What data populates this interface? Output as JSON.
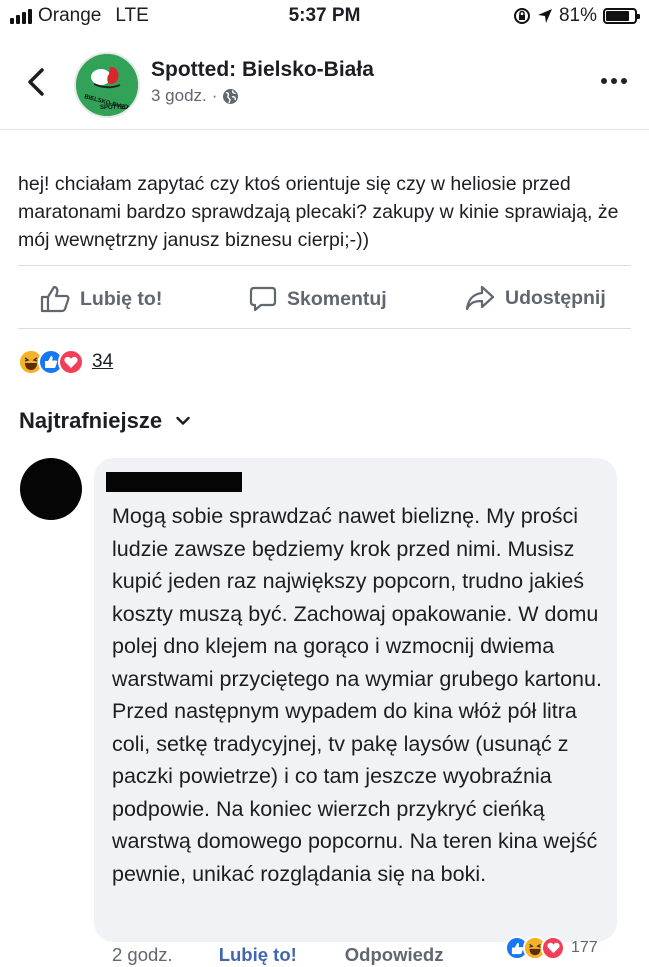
{
  "status_bar": {
    "carrier": "Orange",
    "network": "LTE",
    "time": "5:37 PM",
    "battery": "81%",
    "battery_level": 0.81
  },
  "header": {
    "page_name": "Spotted: Bielsko-Biała",
    "time": "3 godz.",
    "separator": "·",
    "privacy_icon": "globe-icon",
    "avatar_text": "BIELSKO-BIAŁA SPOTTED"
  },
  "post": {
    "text": "hej! chciałam zapytać czy ktoś orientuje się czy w heliosie przed maratonami bardzo sprawdzają plecaki? zakupy w kinie sprawiają, że mój wewnętrzny janusz biznesu cierpi;-))"
  },
  "actions": {
    "like": "Lubię to!",
    "comment": "Skomentuj",
    "share": "Udostępnij"
  },
  "reactions": {
    "icons": [
      "haha-icon",
      "like-icon",
      "love-icon"
    ],
    "count": "34"
  },
  "comments": {
    "sort_label": "Najtrafniejsze",
    "items": [
      {
        "text": "Mogą sobie sprawdzać nawet bieliznę. My prości ludzie zawsze będziemy krok przed nimi. Musisz kupić jeden raz największy popcorn, trudno jakieś koszty muszą być. Zachowaj opakowanie. W domu polej dno klejem na gorąco i wzmocnij dwiema warstwami przyciętego na wymiar grubego kartonu. Przed następnym wypadem do kina włóż pół litra coli, setkę tradycyjnej, tv pakę laysów (usunąć z paczki powietrze) i co tam jeszcze wyobraźnia podpowie. Na koniec wierzch przykryć cieńką warstwą domowego popcornu. Na teren kina wejść pewnie, unikać rozglądania się na boki.",
        "time": "2 godz.",
        "like": "Lubię to!",
        "reply": "Odpowiedz",
        "reaction_icons": [
          "like-icon",
          "haha-icon",
          "love-icon"
        ],
        "reaction_count": "177"
      }
    ]
  },
  "colors": {
    "link_blue": "#4267b2",
    "like_blue": "#1877f2",
    "love_red": "#f33e58",
    "haha_yellow": "#f7b125",
    "gray_text": "#606770",
    "bubble_bg": "#f0f2f5"
  }
}
